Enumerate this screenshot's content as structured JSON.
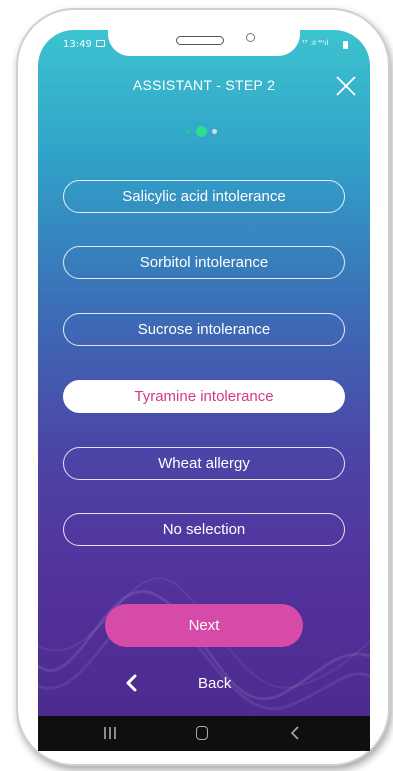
{
  "status_bar": {
    "time": "13:49",
    "right_icons": "¹⁵ .ıl ⁴ᴳıl"
  },
  "header": {
    "title": "ASSISTANT - STEP 2",
    "close_icon": "close-icon"
  },
  "step_indicator": {
    "total": 3,
    "current": 2
  },
  "options": [
    {
      "label": "Salicylic acid intolerance",
      "selected": false
    },
    {
      "label": "Sorbitol intolerance",
      "selected": false
    },
    {
      "label": "Sucrose intolerance",
      "selected": false
    },
    {
      "label": "Tyramine intolerance",
      "selected": true
    },
    {
      "label": "Wheat allergy",
      "selected": false
    },
    {
      "label": "No selection",
      "selected": false
    }
  ],
  "actions": {
    "next_label": "Next",
    "back_label": "Back"
  },
  "colors": {
    "accent": "#d64aa8",
    "selected_text": "#d2398f",
    "active_dot": "#2dde8f",
    "gradient_top": "#3cc3cf",
    "gradient_bottom": "#4b2a8d"
  }
}
